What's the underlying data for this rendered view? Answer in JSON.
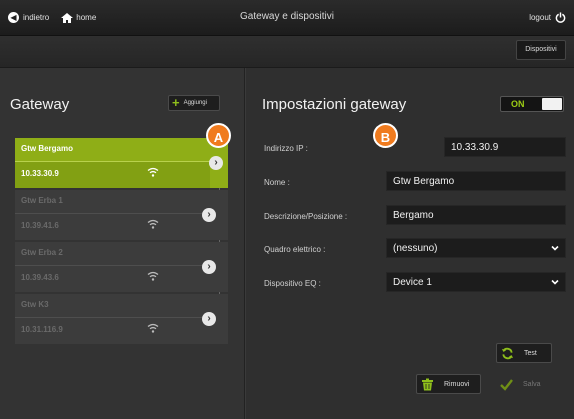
{
  "topbar": {
    "back_label": "indietro",
    "home_label": "home",
    "title": "Gateway e dispositivi",
    "logout_label": "logout",
    "icons": {
      "back": "back-circle-icon",
      "home": "home-icon",
      "logout": "power-icon"
    }
  },
  "subbar": {
    "dispositivi_label": "Dispositivi"
  },
  "gateway_list": {
    "title": "Gateway",
    "add_label": "Aggiungi",
    "items": [
      {
        "name": "Gtw Bergamo",
        "ip": "10.33.30.9",
        "active": true
      },
      {
        "name": "Gtw Erba 1",
        "ip": "10.39.41.6",
        "active": false
      },
      {
        "name": "Gtw Erba 2",
        "ip": "10.39.43.6",
        "active": false
      },
      {
        "name": "Gtw K3",
        "ip": "10.31.116.9",
        "active": false
      }
    ]
  },
  "badges": {
    "a": "A",
    "b": "B"
  },
  "settings": {
    "title": "Impostazioni gateway",
    "toggle_label": "ON",
    "toggle_on": true,
    "fields": {
      "ip": {
        "label": "Indirizzo IP :",
        "value": "10.33.30.9"
      },
      "nome": {
        "label": "Nome :",
        "value": "Gtw Bergamo"
      },
      "descrizione": {
        "label": "Descrizione/Posizione :",
        "value": "Bergamo"
      },
      "quadro": {
        "label": "Quadro elettrico :",
        "value": "(nessuno)"
      },
      "dispositivo": {
        "label": "Dispositivo EQ :",
        "value": "Device 1"
      }
    },
    "test_label": "Test",
    "rimuovi_label": "Rimuovi",
    "salva_label": "Salva"
  },
  "colors": {
    "accent_green": "#8fae17",
    "badge_orange": "#f07b1e",
    "on_green": "#9ccc14",
    "background": "#3a3a3a"
  }
}
